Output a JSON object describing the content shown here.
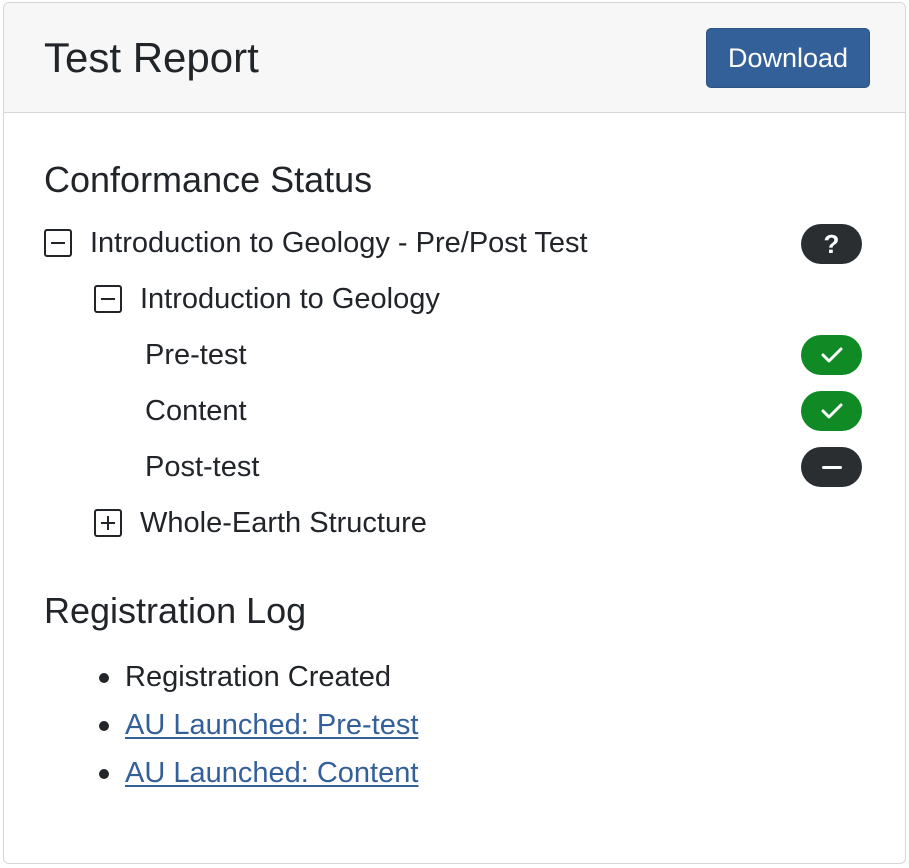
{
  "header": {
    "title": "Test Report",
    "download_label": "Download"
  },
  "conformance": {
    "heading": "Conformance Status",
    "course": {
      "label": "Introduction to Geology - Pre/Post Test",
      "expanded": true,
      "status": "unknown",
      "status_symbol": "?"
    },
    "block": {
      "label": "Introduction to Geology",
      "expanded": true
    },
    "aus": [
      {
        "label": "Pre-test",
        "status": "satisfied",
        "icon": "check-icon"
      },
      {
        "label": "Content",
        "status": "satisfied",
        "icon": "check-icon"
      },
      {
        "label": "Post-test",
        "status": "not-applicable",
        "icon": "minus-icon"
      }
    ],
    "collapsed_block": {
      "label": "Whole-Earth Structure",
      "expanded": false
    }
  },
  "registration_log": {
    "heading": "Registration Log",
    "items": [
      {
        "text": "Registration Created",
        "link": false
      },
      {
        "text": "AU Launched: Pre-test",
        "link": true
      },
      {
        "text": "AU Launched: Content",
        "link": true
      }
    ]
  },
  "colors": {
    "primary": "#346099",
    "success": "#0f8a25",
    "dark": "#2b2e31",
    "header_bg": "#f7f7f7"
  }
}
